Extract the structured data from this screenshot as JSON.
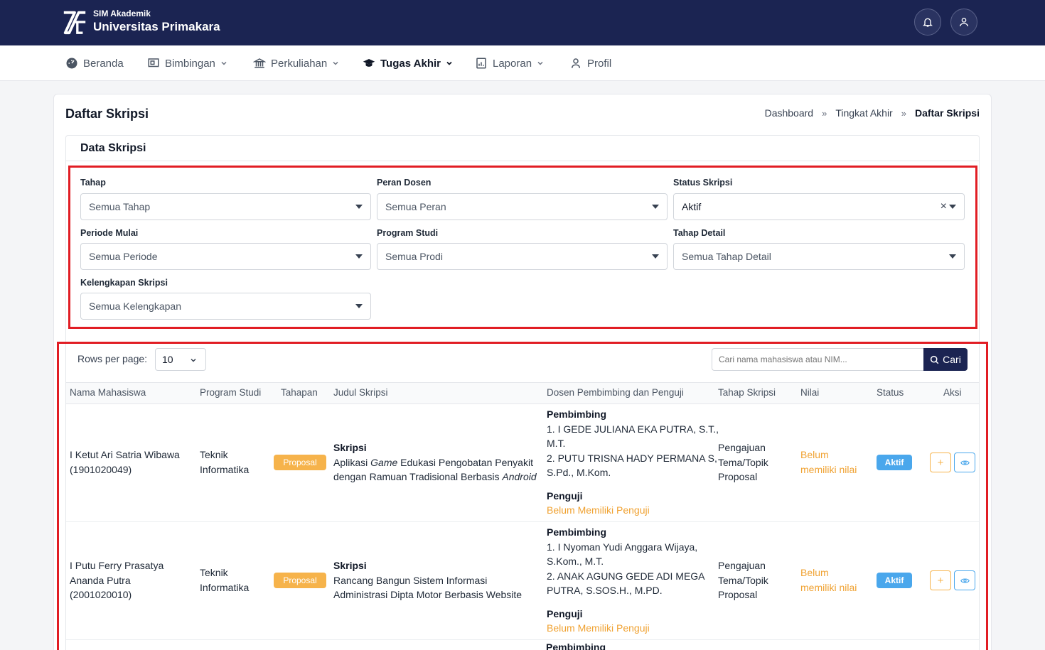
{
  "app": {
    "sub_title": "SIM Akademik",
    "main_title": "Universitas Primakara"
  },
  "nav": [
    {
      "label": "Beranda",
      "icon": "dashboard-icon",
      "dropdown": false,
      "active": false
    },
    {
      "label": "Bimbingan",
      "icon": "presentation-icon",
      "dropdown": true,
      "active": false
    },
    {
      "label": "Perkuliahan",
      "icon": "building-columns-icon",
      "dropdown": true,
      "active": false
    },
    {
      "label": "Tugas Akhir",
      "icon": "graduation-cap-icon",
      "dropdown": true,
      "active": true
    },
    {
      "label": "Laporan",
      "icon": "report-chart-icon",
      "dropdown": true,
      "active": false
    },
    {
      "label": "Profil",
      "icon": "user-icon",
      "dropdown": false,
      "active": false
    }
  ],
  "page": {
    "title": "Daftar Skripsi",
    "breadcrumb": [
      "Dashboard",
      "Tingkat Akhir",
      "Daftar Skripsi"
    ],
    "breadcrumb_sep": "»"
  },
  "section": {
    "title": "Data Skripsi"
  },
  "filters": {
    "tahap": {
      "label": "Tahap",
      "value": "Semua Tahap"
    },
    "peran_dosen": {
      "label": "Peran Dosen",
      "value": "Semua Peran"
    },
    "status_skripsi": {
      "label": "Status Skripsi",
      "value": "Aktif",
      "clear": "×"
    },
    "periode_mulai": {
      "label": "Periode Mulai",
      "value": "Semua Periode"
    },
    "program_studi": {
      "label": "Program Studi",
      "value": "Semua Prodi"
    },
    "tahap_detail": {
      "label": "Tahap Detail",
      "value": "Semua Tahap Detail"
    },
    "kelengkapan": {
      "label": "Kelengkapan Skripsi",
      "value": "Semua Kelengkapan"
    }
  },
  "table": {
    "rows_label": "Rows per page:",
    "rows_value": "10",
    "search_placeholder": "Cari nama mahasiswa atau NIM...",
    "search_button": "Cari",
    "headers": [
      "Nama Mahasiswa",
      "Program Studi",
      "Tahapan",
      "Judul Skripsi",
      "Dosen Pembimbing dan Penguji",
      "Tahap Skripsi",
      "Nilai",
      "Status",
      "Aksi"
    ],
    "rows": [
      {
        "nama_line1": "I Ketut Ari Satria Wibawa",
        "nama_line2": "(1901020049)",
        "nama_line3": "",
        "prodi_line1": "Teknik",
        "prodi_line2": "Informatika",
        "tahapan": "Proposal",
        "judul_type": "Skripsi",
        "judul_p1": "Aplikasi ",
        "judul_i1": "Game",
        "judul_p2": " Edukasi Pengobatan Penyakit",
        "judul_p3": "dengan Ramuan Tradisional Berbasis ",
        "judul_i2": "Android",
        "pembimbing_label": "Pembimbing",
        "pembimbing_1a": "1. I GEDE JULIANA EKA PUTRA, S.T.,",
        "pembimbing_1b": "M.T.",
        "pembimbing_2a": "2. PUTU TRISNA HADY PERMANA S,",
        "pembimbing_2b": "S.Pd., M.Kom.",
        "penguji_label": "Penguji",
        "penguji_value": "Belum Memiliki Penguji",
        "tahap_line1": "Pengajuan",
        "tahap_line2": "Tema/Topik",
        "tahap_line3": "Proposal",
        "nilai_line1": "Belum",
        "nilai_line2": "memiliki nilai",
        "status": "Aktif",
        "add_symbol": "+"
      },
      {
        "nama_line1": "I Putu Ferry Prasatya",
        "nama_line2": "Ananda Putra",
        "nama_line3": "(2001020010)",
        "prodi_line1": "Teknik",
        "prodi_line2": "Informatika",
        "tahapan": "Proposal",
        "judul_type": "Skripsi",
        "judul_line1": "Rancang Bangun Sistem Informasi",
        "judul_line2": "Administrasi Dipta Motor Berbasis Website",
        "pembimbing_label": "Pembimbing",
        "pembimbing_1a": "1. I Nyoman Yudi Anggara Wijaya,",
        "pembimbing_1b": "S.Kom., M.T.",
        "pembimbing_2a": "2. ANAK AGUNG GEDE ADI MEGA",
        "pembimbing_2b": "PUTRA, S.SOS.H., M.PD.",
        "penguji_label": "Penguji",
        "penguji_value": "Belum Memiliki Penguji",
        "tahap_line1": "Pengajuan",
        "tahap_line2": "Tema/Topik",
        "tahap_line3": "Proposal",
        "nilai_line1": "Belum",
        "nilai_line2": "memiliki nilai",
        "status": "Aktif",
        "add_symbol": "+"
      }
    ],
    "partial_row_label": "Pembimbing"
  },
  "colors": {
    "primary": "#1b2452",
    "warning": "#f6b34b",
    "info": "#4aa7ec",
    "highlight": "#e11d24"
  }
}
